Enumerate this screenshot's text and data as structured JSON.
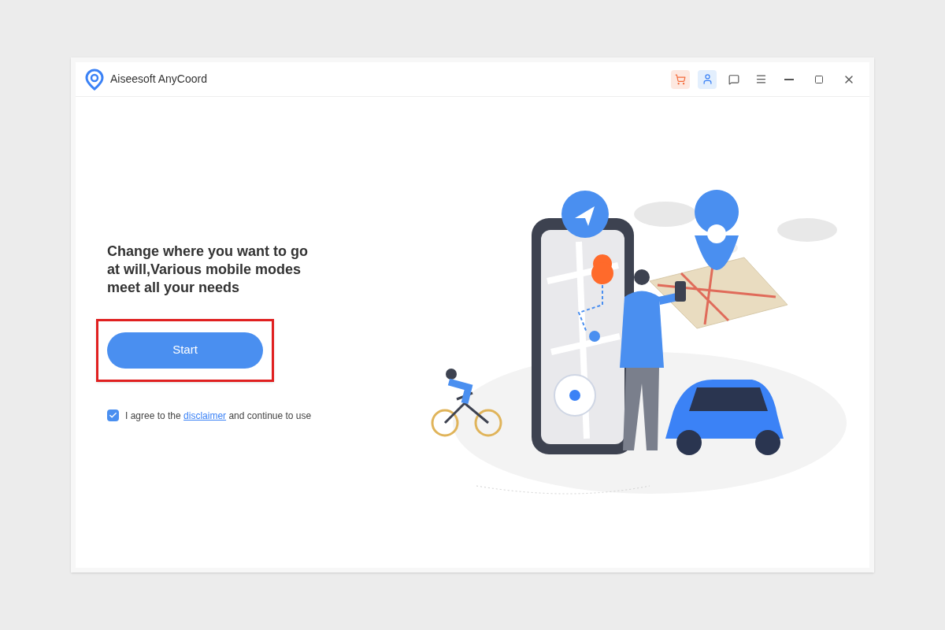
{
  "window": {
    "title": "Aiseesoft AnyCoord"
  },
  "headline": "Change where you want to go at will,Various mobile modes meet all your needs",
  "start_button": {
    "label": "Start",
    "highlighted": true
  },
  "agreement": {
    "checked": true,
    "text_before": "I agree to the",
    "link": "disclaimer",
    "text_after": "and continue to use"
  }
}
